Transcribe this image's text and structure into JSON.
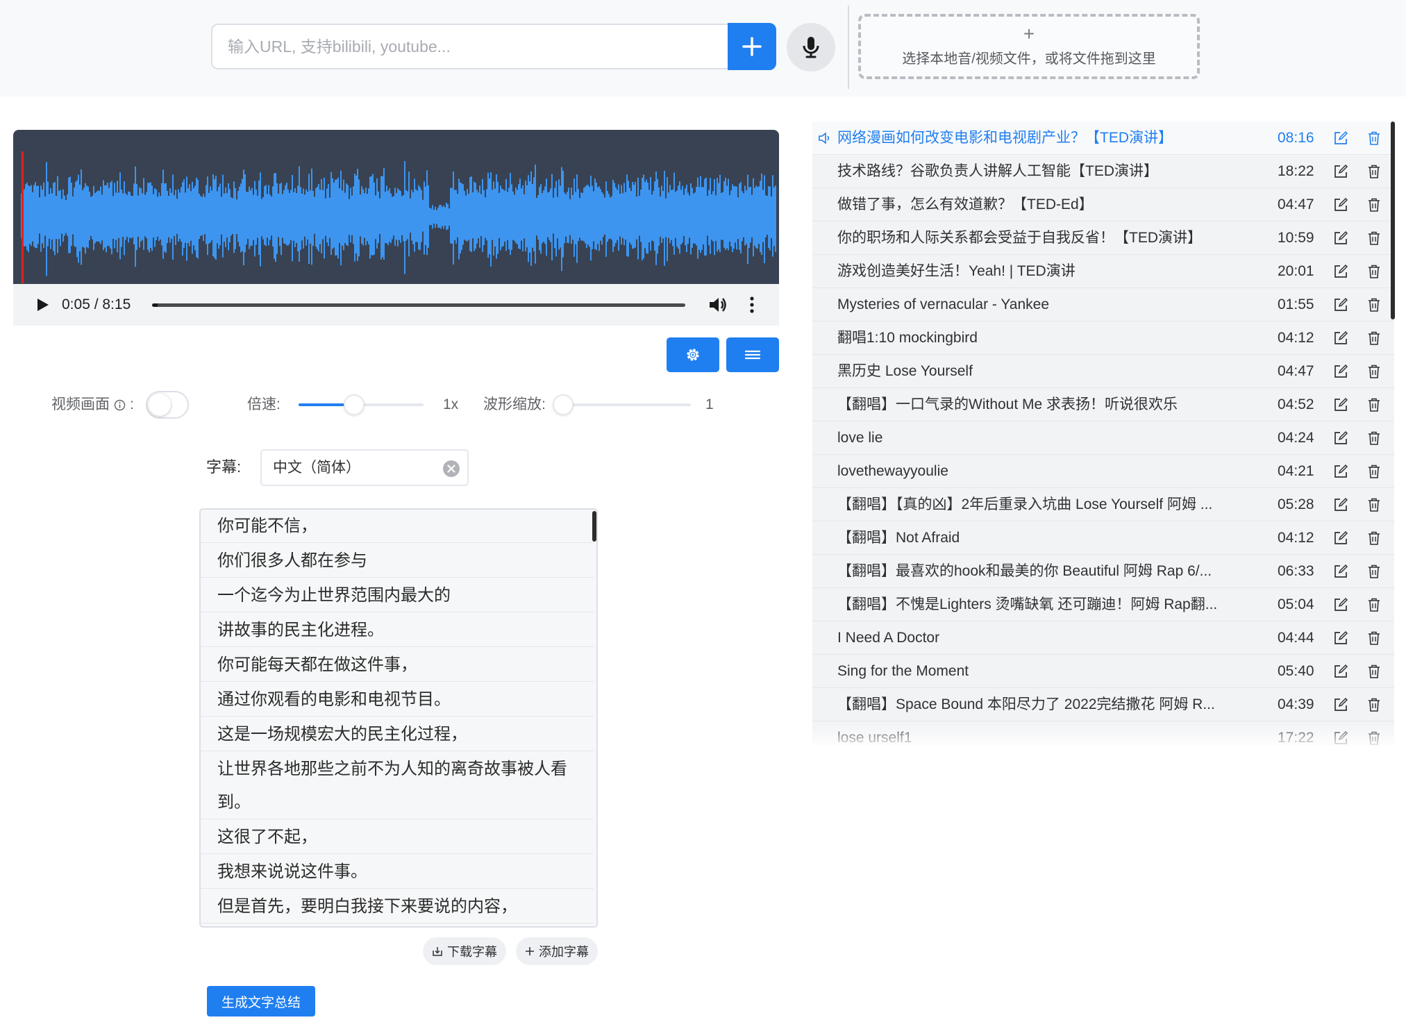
{
  "topbar": {
    "url_placeholder": "输入URL, 支持bilibili, youtube...",
    "url_value": "",
    "dropzone_plus": "+",
    "dropzone_text": "选择本地音/视频文件，或将文件拖到这里"
  },
  "player": {
    "time": "0:05 / 8:15",
    "position_seconds": 5,
    "duration_seconds": 495
  },
  "controls": {
    "video_label": "视频画面",
    "video_enabled": false,
    "speed_label": "倍速:",
    "speed_value": "1x",
    "zoom_label": "波形缩放:",
    "zoom_value": "1"
  },
  "subtitle": {
    "label": "字幕:",
    "selected": "中文（简体）",
    "lines": [
      "你可能不信，",
      "你们很多人都在参与",
      "一个迄今为止世界范围内最大的",
      "讲故事的民主化进程。",
      "你可能每天都在做这件事，",
      "通过你观看的电影和电视节目。",
      "这是一场规模宏大的民主化过程，",
      "让世界各地那些之前不为人知的离奇故事被人看",
      "到。",
      "这很了不起，",
      "我想来说说这件事。",
      "但是首先，要明白我接下来要说的内容，"
    ],
    "download_label": "下载字幕",
    "add_label": "添加字幕",
    "summarize_label": "生成文字总结"
  },
  "playlist": [
    {
      "title": "网络漫画如何改变电影和电视剧产业？【TED演讲】",
      "duration": "08:16",
      "active": true
    },
    {
      "title": "技术路线？谷歌负责人讲解人工智能【TED演讲】",
      "duration": "18:22"
    },
    {
      "title": "做错了事，怎么有效道歉？【TED-Ed】",
      "duration": "04:47"
    },
    {
      "title": "你的职场和人际关系都会受益于自我反省！【TED演讲】",
      "duration": "10:59"
    },
    {
      "title": "游戏创造美好生活！Yeah! | TED演讲",
      "duration": "20:01"
    },
    {
      "title": "Mysteries of vernacular - Yankee",
      "duration": "01:55"
    },
    {
      "title": "翻唱1:10 mockingbird",
      "duration": "04:12"
    },
    {
      "title": "黑历史 Lose Yourself",
      "duration": "04:47"
    },
    {
      "title": "【翻唱】一口气录的Without Me 求表扬！听说很欢乐",
      "duration": "04:52"
    },
    {
      "title": "love lie",
      "duration": "04:24"
    },
    {
      "title": "lovethewayyoulie",
      "duration": "04:21"
    },
    {
      "title": "【翻唱】【真的凶】2年后重录入坑曲 Lose Yourself 阿姆 ...",
      "duration": "05:28"
    },
    {
      "title": "【翻唱】Not Afraid",
      "duration": "04:12"
    },
    {
      "title": "【翻唱】最喜欢的hook和最美的你 Beautiful 阿姆 Rap 6/...",
      "duration": "06:33"
    },
    {
      "title": "【翻唱】不愧是Lighters 烫嘴缺氧 还可蹦迪！阿姆 Rap翻...",
      "duration": "05:04"
    },
    {
      "title": "I Need A Doctor",
      "duration": "04:44"
    },
    {
      "title": "Sing for the Moment",
      "duration": "05:40"
    },
    {
      "title": "【翻唱】Space Bound 本阳尽力了 2022完结撒花 阿姆 R...",
      "duration": "04:39"
    },
    {
      "title": "lose urself1",
      "duration": "17:22"
    }
  ],
  "colors": {
    "accent": "#1f7ff0",
    "waveform_bg": "#384252",
    "waveform_wave": "#3d95f0",
    "playhead": "#e02020"
  },
  "icons": {
    "add": "plus-icon",
    "mic": "microphone-icon",
    "play": "play-icon",
    "volume": "volume-icon",
    "more": "more-vertical-icon",
    "settings": "gear-icon",
    "menu": "list-icon",
    "info": "info-icon",
    "clear": "clear-circle-icon",
    "download": "download-icon",
    "add_small": "plus-icon",
    "edit": "edit-icon",
    "delete": "trash-icon",
    "now_playing": "speaker-icon"
  }
}
